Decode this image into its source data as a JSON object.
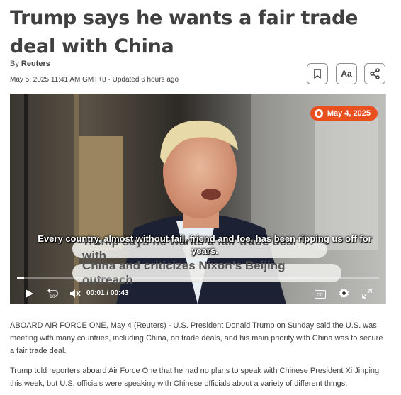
{
  "article": {
    "headline": "Trump says he wants a fair trade deal with China",
    "byline_prefix": "By",
    "author": "Reuters",
    "dateline": "May 5, 2025 11:41 AM GMT+8 · Updated 6 hours ago",
    "font_size_label": "Aa"
  },
  "video": {
    "date_badge": "May 4, 2025",
    "burned_line_1": "Trump says he wants a fair trade deal with",
    "burned_line_2": "China and criticizes Nixon’s Beijing outreach",
    "caption": "Every country, almost without fail, friend and foe, has been ripping us off for years.",
    "current_time": "00:01",
    "duration": "00:43",
    "time_display": "00:01 / 00:43",
    "progress_fraction": 0.02,
    "cc_label": "CC"
  },
  "body": {
    "paragraph_1": "ABOARD AIR FORCE ONE, May 4 (Reuters) - U.S. President Donald Trump on Sunday said the U.S. was meeting with many countries, including China, on trade deals, and his main priority with China was to secure a fair trade deal.",
    "paragraph_2": "Trump told reporters aboard Air Force One that he had no plans to speak with Chinese President Xi Jinping this week, but U.S. officials were speaking with Chinese officials about a variety of different things."
  },
  "icons": {
    "bookmark": "bookmark-icon",
    "share": "share-icon",
    "play": "play-icon",
    "rewind": "rewind-10-icon",
    "mute": "mute-icon",
    "captions": "captions-icon",
    "settings": "gear-icon",
    "fullscreen": "fullscreen-icon"
  },
  "colors": {
    "accent": "#e94f1f",
    "text": "#404040"
  }
}
